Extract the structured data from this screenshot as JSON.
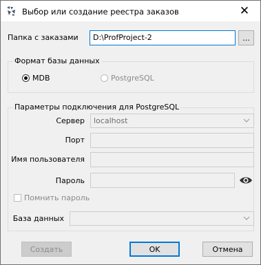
{
  "window": {
    "title": "Выбор или создание  реестра заказов",
    "close_glyph": "✕"
  },
  "folder": {
    "label": "Папка с заказами",
    "value": "D:\\ProfProject-2",
    "browse_label": "..."
  },
  "db_format": {
    "title": "Формат базы данных",
    "options": [
      {
        "label": "MDB",
        "checked": true,
        "enabled": true
      },
      {
        "label": "PostgreSQL",
        "checked": false,
        "enabled": false
      }
    ]
  },
  "pg": {
    "title": "Параметры подключения для PostgreSQL",
    "server_label": "Сервер",
    "server_value": "localhost",
    "port_label": "Порт",
    "port_value": "",
    "user_label": "Имя пользователя",
    "user_value": "",
    "password_label": "Пароль",
    "password_value": "",
    "remember_label": "Помнить пароль",
    "database_label": "База данных",
    "database_value": ""
  },
  "buttons": {
    "create": "Создать",
    "ok": "OK",
    "cancel": "Отмена"
  },
  "icons": {
    "app": "app-logo-icon",
    "close": "close-icon",
    "eye": "eye-icon",
    "dropdown": "chevron-down-icon"
  }
}
